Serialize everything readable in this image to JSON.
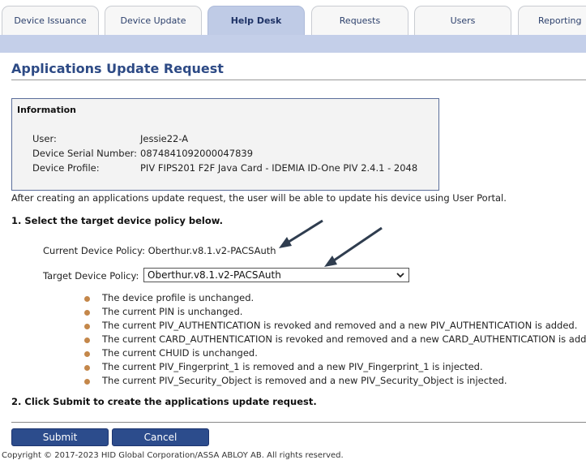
{
  "tabs": [
    {
      "label": "Device Issuance"
    },
    {
      "label": "Device Update"
    },
    {
      "label": "Help Desk"
    },
    {
      "label": "Requests"
    },
    {
      "label": "Users"
    },
    {
      "label": "Reporting"
    }
  ],
  "active_tab": "Help Desk",
  "page": {
    "title": "Applications Update Request"
  },
  "info": {
    "heading": "Information",
    "user_label": "User:",
    "user_value": "Jessie22-A",
    "serial_label": "Device Serial Number:",
    "serial_value": "0874841092000047839",
    "profile_label": "Device Profile:",
    "profile_value": "PIV FIPS201 F2F Java Card - IDEMIA ID-One PIV 2.4.1 - 2048"
  },
  "intro": "After creating an applications update request, the user will be able to update his device using User Portal.",
  "step1": "1. Select the target device policy below.",
  "current_policy": {
    "label": "Current Device Policy:",
    "value": "Oberthur.v8.1.v2-PACSAuth"
  },
  "target_policy": {
    "label": "Target Device Policy:",
    "selected": "Oberthur.v8.1.v2-PACSAuth"
  },
  "changes": [
    "The device profile is unchanged.",
    "The current PIN is unchanged.",
    "The current PIV_AUTHENTICATION is revoked and removed and a new PIV_AUTHENTICATION is added.",
    "The current CARD_AUTHENTICATION is revoked and removed and a new CARD_AUTHENTICATION is added.",
    "The current CHUID is unchanged.",
    "The current PIV_Fingerprint_1 is removed and a new PIV_Fingerprint_1 is injected.",
    "The current PIV_Security_Object is removed and a new PIV_Security_Object is injected."
  ],
  "step2": "2. Click Submit to create the applications update request.",
  "buttons": {
    "submit": "Submit",
    "cancel": "Cancel"
  },
  "footer": {
    "copyright": "Copyright © 2017-2023 HID Global Corporation/ASSA ABLOY AB. All rights reserved."
  },
  "colors": {
    "accent": "#2d4a85",
    "tab_active": "#bfcbe6",
    "bullet": "#c4874a",
    "button": "#2c4c8c"
  },
  "icons": {
    "select_arrow": "chevron-down-icon",
    "bullet": "bullet-dot-icon",
    "annotation": "arrow-icon"
  }
}
